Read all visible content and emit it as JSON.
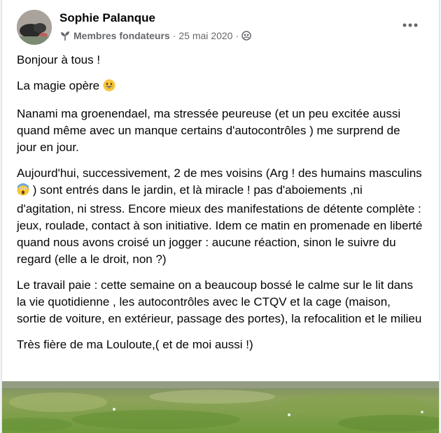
{
  "post": {
    "author": "Sophie Palanque",
    "role": "Membres fondateurs",
    "separator": "·",
    "date": "25 mai 2020",
    "separator2": "·",
    "paragraphs": {
      "p1": "Bonjour à tous !",
      "p2": "La magie opère",
      "p3": "Nanami ma groenendael, ma stressée peureuse (et un peu excitée aussi quand même avec un manque certains d'autocontrôles )  me surprend de jour en jour.",
      "p4a": "Aujourd'hui, successivement, 2 de mes voisins (Arg ! des humains masculins",
      "p4b": ") sont entrés dans le jardin, et là miracle ! pas d'aboiements ,ni d'agitation, ni stress. Encore mieux des manifestations de détente complète : jeux, roulade, contact à son initiative. Idem ce matin en promenade en liberté quand nous avons croisé un jogger : aucune réaction, sinon le suivre du regard (elle a le droit, non ?)",
      "p5": "Le travail paie : cette semaine on a beaucoup bossé le calme sur le lit dans la vie quotidienne , les autocontrôles avec le CTQV et la cage (maison, sortie de voiture, en extérieur, passage des portes), la refocalition et le milieu",
      "p6": "Très fière de ma Louloute,( et de moi aussi !)"
    }
  },
  "icons": {
    "role_icon": "sprout-icon",
    "audience_icon": "members-audience-icon",
    "more_icon": "more-options-icon",
    "emoji_smile": "grinning-face-emoji",
    "emoji_scream": "face-screaming-emoji"
  },
  "colors": {
    "text_primary": "#050505",
    "text_secondary": "#65676b",
    "card_bg": "#ffffff",
    "page_bg": "#f0f2f5"
  }
}
